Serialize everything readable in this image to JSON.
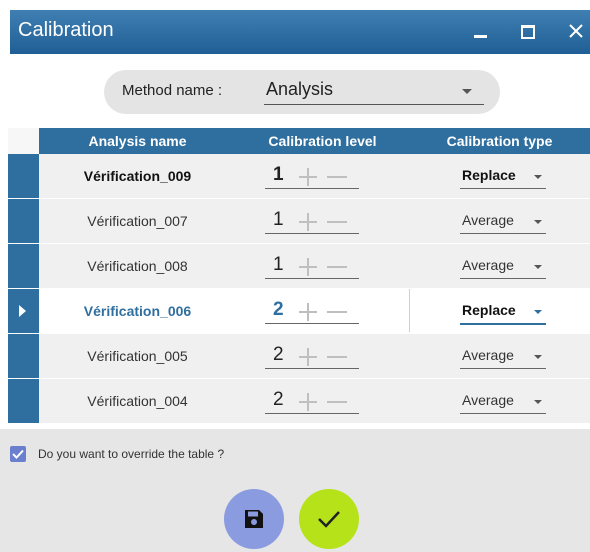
{
  "window": {
    "title": "Calibration"
  },
  "method": {
    "label": "Method name :",
    "value": "Analysis"
  },
  "table": {
    "columns": [
      "Analysis name",
      "Calibration level",
      "Calibration type"
    ],
    "rows": [
      {
        "name": "Vérification_009",
        "level": "1",
        "type": "Replace"
      },
      {
        "name": "Vérification_007",
        "level": "1",
        "type": "Average"
      },
      {
        "name": "Vérification_008",
        "level": "1",
        "type": "Average"
      },
      {
        "name": "Vérification_006",
        "level": "2",
        "type": "Replace"
      },
      {
        "name": "Vérification_005",
        "level": "2",
        "type": "Average"
      },
      {
        "name": "Vérification_004",
        "level": "2",
        "type": "Average"
      }
    ]
  },
  "override": {
    "label": "Do you want to override the table ?",
    "checked": true
  },
  "colors": {
    "titlebar": "#2f6f9f",
    "accent": "#2f6f9f",
    "save_button": "#8a9be0",
    "ok_button": "#b6e21a"
  },
  "icons": {
    "save": "floppy-disk-icon",
    "confirm": "checkmark-icon"
  }
}
